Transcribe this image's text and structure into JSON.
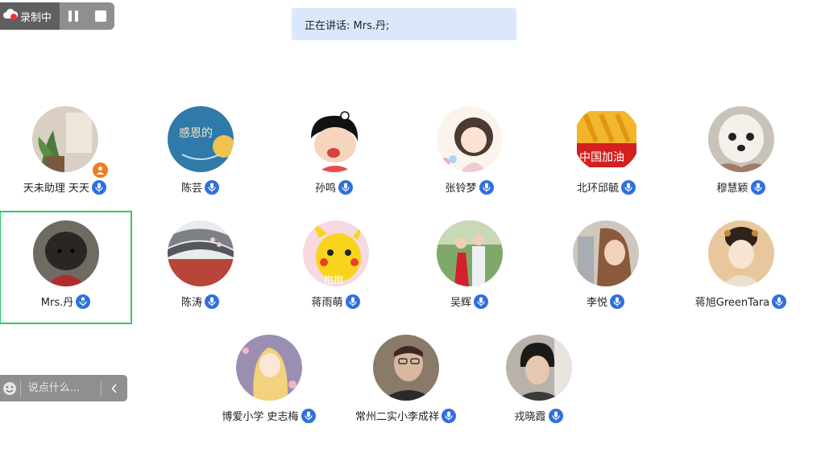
{
  "recording": {
    "label": "录制中",
    "pause_icon": "pause-icon",
    "stop_icon": "stop-icon",
    "cloud_icon": "cloud-record-icon"
  },
  "speaking": {
    "text": "正在讲话: Mrs.丹;"
  },
  "participants": [
    {
      "name": "天未助理 天天",
      "host": true
    },
    {
      "name": "陈芸"
    },
    {
      "name": "孙鸣"
    },
    {
      "name": "张铃梦"
    },
    {
      "name": "北环邱毓"
    },
    {
      "name": "穆慧颖"
    },
    {
      "name": "Mrs.丹",
      "speaking": true
    },
    {
      "name": "陈涛"
    },
    {
      "name": "蒋雨萌"
    },
    {
      "name": "吴辉"
    },
    {
      "name": "李悦"
    },
    {
      "name": "蒋旭GreenTara"
    },
    {
      "name": "博爱小学 史志梅"
    },
    {
      "name": "常州二实小李成祥"
    },
    {
      "name": "戎晓霞"
    }
  ],
  "avatar_texts": {
    "chenyun": "感恩的",
    "beihuan": "中国加油",
    "jiangyumeng": "抱抱"
  },
  "chat": {
    "placeholder": "说点什么...",
    "emoji_icon": "emoji-icon",
    "collapse_icon": "chevron-left-icon"
  },
  "colors": {
    "mic_blue": "#2f6fe0",
    "active_border": "#35c46f",
    "banner_bg": "#dbe8fb",
    "host_orange": "#f27a22"
  }
}
